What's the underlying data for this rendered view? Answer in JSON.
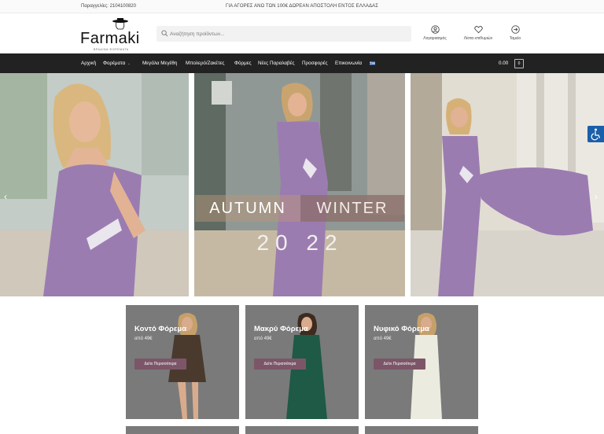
{
  "topbar": {
    "orders": "Παραγγελίες: 2104100820",
    "shipping": "ΓΙΑ ΑΓΟΡΕΣ ΑΝΩ ΤΩΝ 100€ ΔΩΡΕΑΝ ΑΠΟΣΤΟΛΗ ΕΝΤΟΣ ΕΛΛΑΔΑΣ"
  },
  "header": {
    "logo_text": "Farmaki",
    "logo_tagline": "ΒΡΑΔΙΝΑ ΦΟΡΕΜΑΤΑ",
    "search_placeholder": "Αναζήτηση προϊόντων...",
    "actions": [
      {
        "label": "Λογαριασμός",
        "icon": "user-icon"
      },
      {
        "label": "Λίστα επιθυμιών",
        "icon": "heart-icon"
      },
      {
        "label": "Ταμείο",
        "icon": "arrow-right-circle-icon"
      }
    ]
  },
  "nav": {
    "items": [
      "Αρχική",
      "Φορέματα",
      "Μεγάλα Μεγέθη",
      "Μπολερό/Ζακέτες",
      "Φόρμες",
      "Νέες Παραλαβές",
      "Προσφορές",
      "Επικοινωνία"
    ],
    "dropdown_item": "Φορέματα",
    "cart_total": "0.00",
    "cart_count": "0",
    "language": "greek-flag-icon"
  },
  "hero": {
    "word_left": "AUTUMN",
    "word_right": "WINTER",
    "year": "20 22",
    "prev_arrow": "‹",
    "next_arrow": "›",
    "dress_color": "#9b7cb0"
  },
  "categories": [
    {
      "name": "Κοντό Φόρεμα",
      "price": "από 49€",
      "button": "Δείτε Περισσότερα",
      "dress_color": "#4a3a2e"
    },
    {
      "name": "Μακρύ Φόρεμα",
      "price": "από 49€",
      "button": "Δείτε Περισσότερα",
      "dress_color": "#1e5a45"
    },
    {
      "name": "Νυφικό Φόρεμα",
      "price": "από 49€",
      "button": "Δείτε Περισσότερα",
      "dress_color": "#ecebe0"
    }
  ],
  "colors": {
    "nav_bg": "#222222",
    "button_bg": "#7c5668",
    "accessibility_blue": "#1b5faa"
  }
}
